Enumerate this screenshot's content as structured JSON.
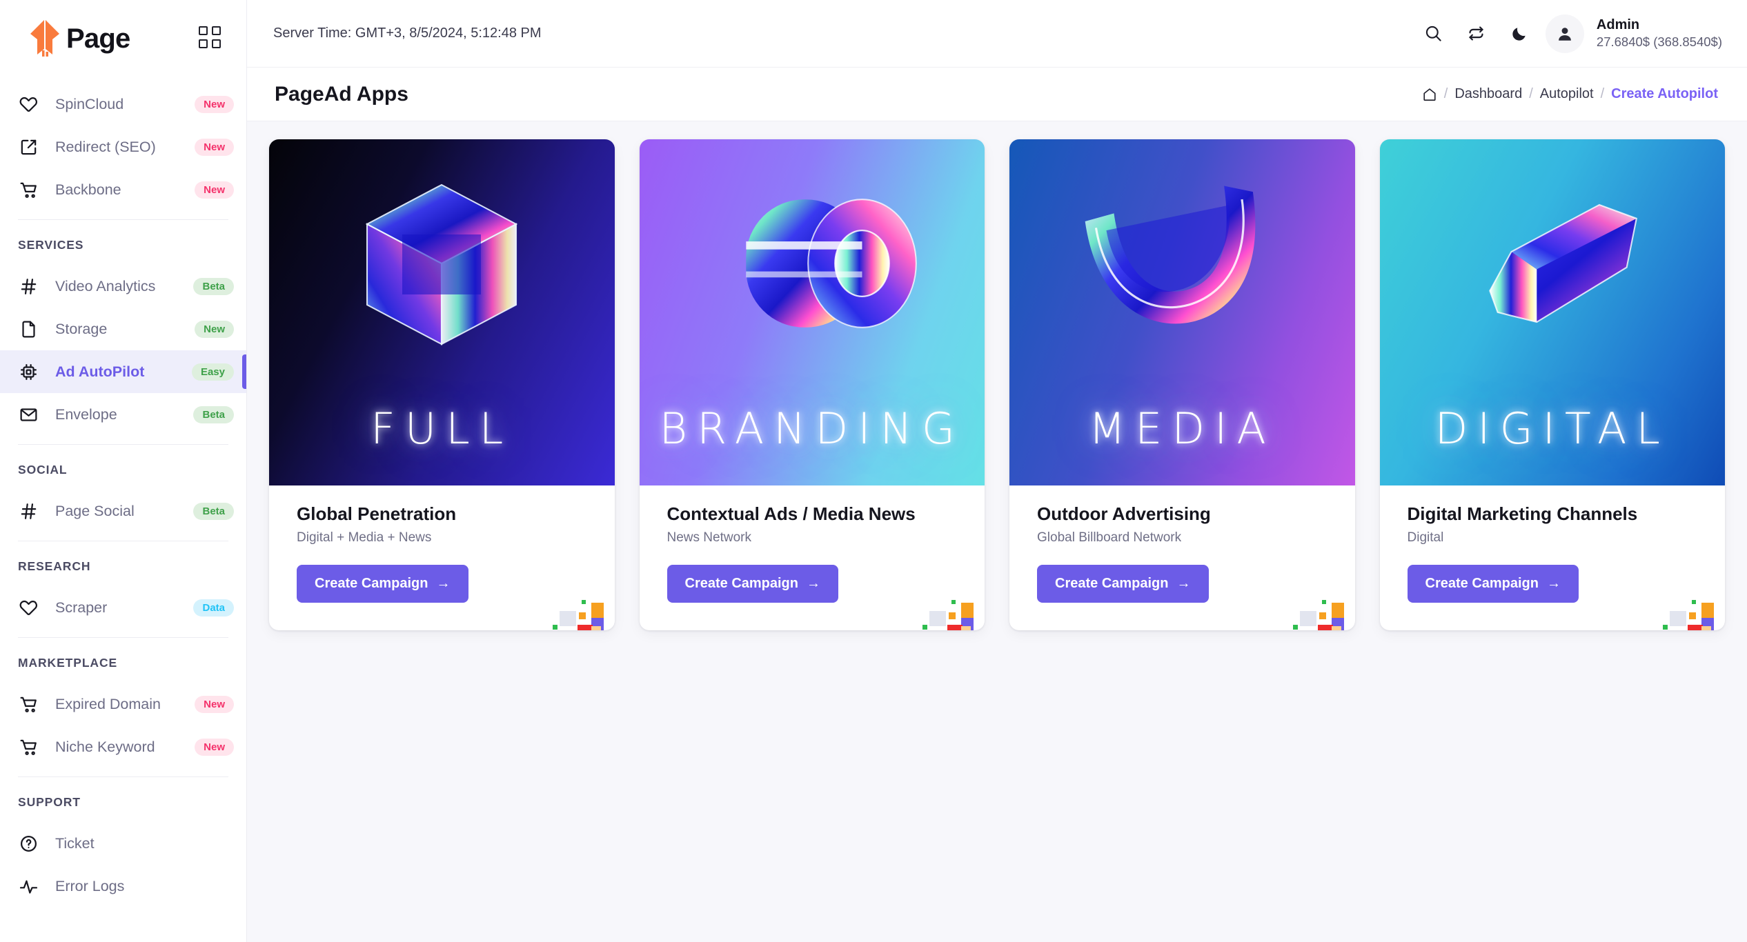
{
  "brand": {
    "name": "Page",
    "logo_icon": "page-origami-logo",
    "grid_toggle_icon": "grid-toggle-icon"
  },
  "sidebar": {
    "top_items": [
      {
        "label": "SpinCloud",
        "icon": "heart-icon",
        "badge": "New",
        "badge_type": "new"
      },
      {
        "label": "Redirect (SEO)",
        "icon": "external-link-icon",
        "badge": "New",
        "badge_type": "new"
      },
      {
        "label": "Backbone",
        "icon": "cart-icon",
        "badge": "New",
        "badge_type": "new"
      }
    ],
    "groups": [
      {
        "title": "SERVICES",
        "items": [
          {
            "label": "Video Analytics",
            "icon": "hash-icon",
            "badge": "Beta",
            "badge_type": "green",
            "active": false
          },
          {
            "label": "Storage",
            "icon": "file-icon",
            "badge": "New",
            "badge_type": "green",
            "active": false
          },
          {
            "label": "Ad AutoPilot",
            "icon": "cpu-icon",
            "badge": "Easy",
            "badge_type": "green",
            "active": true
          },
          {
            "label": "Envelope",
            "icon": "mail-icon",
            "badge": "Beta",
            "badge_type": "green",
            "active": false
          }
        ]
      },
      {
        "title": "SOCIAL",
        "items": [
          {
            "label": "Page Social",
            "icon": "hash-icon",
            "badge": "Beta",
            "badge_type": "green",
            "active": false
          }
        ]
      },
      {
        "title": "RESEARCH",
        "items": [
          {
            "label": "Scraper",
            "icon": "heart-icon",
            "badge": "Data",
            "badge_type": "data",
            "active": false
          }
        ]
      },
      {
        "title": "MARKETPLACE",
        "items": [
          {
            "label": "Expired Domain",
            "icon": "cart-icon",
            "badge": "New",
            "badge_type": "new",
            "active": false
          },
          {
            "label": "Niche Keyword",
            "icon": "cart-icon",
            "badge": "New",
            "badge_type": "new",
            "active": false
          }
        ]
      },
      {
        "title": "SUPPORT",
        "items": [
          {
            "label": "Ticket",
            "icon": "help-circle-icon",
            "badge": "",
            "badge_type": "",
            "active": false
          },
          {
            "label": "Error Logs",
            "icon": "activity-icon",
            "badge": "",
            "badge_type": "",
            "active": false
          }
        ]
      }
    ]
  },
  "topbar": {
    "server_time": "Server Time: GMT+3, 8/5/2024, 5:12:48 PM",
    "icons": [
      "search-icon",
      "refresh-icon",
      "moon-icon"
    ],
    "user": {
      "name": "Admin",
      "balance": "27.6840$ (368.8540$)",
      "avatar_icon": "user-avatar-icon"
    }
  },
  "pagehead": {
    "title": "PageAd Apps",
    "breadcrumb": {
      "home_icon": "home-icon",
      "separator": "/",
      "items": [
        {
          "label": "Dashboard",
          "current": false
        },
        {
          "label": "Autopilot",
          "current": false
        },
        {
          "label": "Create Autopilot",
          "current": true
        }
      ]
    }
  },
  "cards": [
    {
      "neon_word": "FULL",
      "title": "Global Penetration",
      "subtitle": "Digital + Media + News",
      "cta_label": "Create Campaign",
      "cta_arrow": "→",
      "theme": "g-full",
      "shape": "cube"
    },
    {
      "neon_word": "BRANDING",
      "title": "Contextual Ads / Media News",
      "subtitle": "News Network",
      "cta_label": "Create Campaign",
      "cta_arrow": "→",
      "theme": "g-brand",
      "shape": "torus"
    },
    {
      "neon_word": "MEDIA",
      "title": "Outdoor Advertising",
      "subtitle": "Global Billboard Network",
      "cta_label": "Create Campaign",
      "cta_arrow": "→",
      "theme": "g-media",
      "shape": "arc"
    },
    {
      "neon_word": "DIGITAL",
      "title": "Digital Marketing Channels",
      "subtitle": "Digital",
      "cta_label": "Create Campaign",
      "cta_arrow": "→",
      "theme": "g-digi",
      "shape": "prism"
    }
  ],
  "colors": {
    "accent_purple": "#6C5CE7",
    "breadcrumb_current": "#7A62F5",
    "badge_new_bg": "#FFE4EC",
    "badge_new_text": "#F4326B",
    "badge_green_bg": "#DEEFDE",
    "badge_green_text": "#3FA14A",
    "badge_data_bg": "#D4F2FD",
    "badge_data_text": "#21C3F6",
    "content_bg": "#F7F7FB",
    "logo_orange": "#F97B3D"
  }
}
